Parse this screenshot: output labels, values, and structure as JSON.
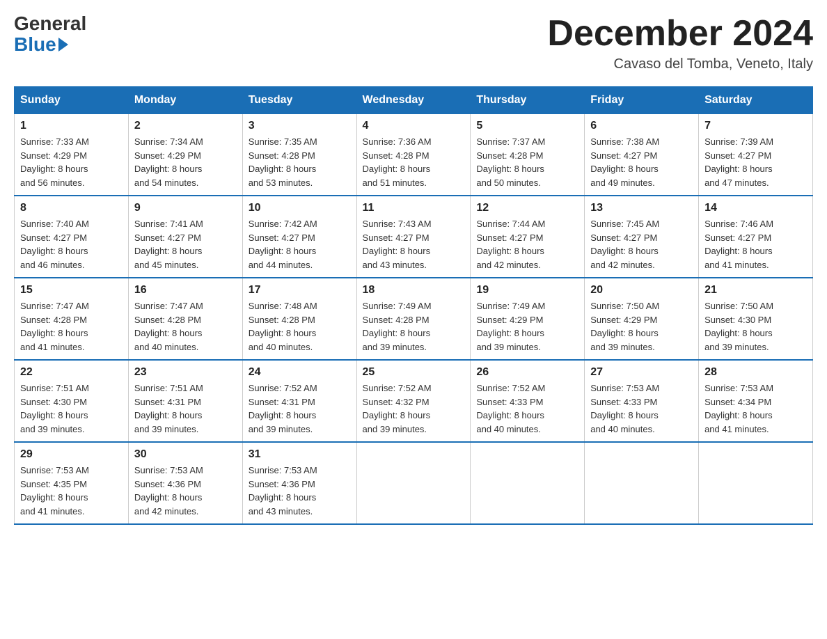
{
  "logo": {
    "general": "General",
    "blue": "Blue"
  },
  "title": "December 2024",
  "location": "Cavaso del Tomba, Veneto, Italy",
  "days_of_week": [
    "Sunday",
    "Monday",
    "Tuesday",
    "Wednesday",
    "Thursday",
    "Friday",
    "Saturday"
  ],
  "weeks": [
    [
      {
        "day": "1",
        "sunrise": "7:33 AM",
        "sunset": "4:29 PM",
        "daylight": "8 hours and 56 minutes."
      },
      {
        "day": "2",
        "sunrise": "7:34 AM",
        "sunset": "4:29 PM",
        "daylight": "8 hours and 54 minutes."
      },
      {
        "day": "3",
        "sunrise": "7:35 AM",
        "sunset": "4:28 PM",
        "daylight": "8 hours and 53 minutes."
      },
      {
        "day": "4",
        "sunrise": "7:36 AM",
        "sunset": "4:28 PM",
        "daylight": "8 hours and 51 minutes."
      },
      {
        "day": "5",
        "sunrise": "7:37 AM",
        "sunset": "4:28 PM",
        "daylight": "8 hours and 50 minutes."
      },
      {
        "day": "6",
        "sunrise": "7:38 AM",
        "sunset": "4:27 PM",
        "daylight": "8 hours and 49 minutes."
      },
      {
        "day": "7",
        "sunrise": "7:39 AM",
        "sunset": "4:27 PM",
        "daylight": "8 hours and 47 minutes."
      }
    ],
    [
      {
        "day": "8",
        "sunrise": "7:40 AM",
        "sunset": "4:27 PM",
        "daylight": "8 hours and 46 minutes."
      },
      {
        "day": "9",
        "sunrise": "7:41 AM",
        "sunset": "4:27 PM",
        "daylight": "8 hours and 45 minutes."
      },
      {
        "day": "10",
        "sunrise": "7:42 AM",
        "sunset": "4:27 PM",
        "daylight": "8 hours and 44 minutes."
      },
      {
        "day": "11",
        "sunrise": "7:43 AM",
        "sunset": "4:27 PM",
        "daylight": "8 hours and 43 minutes."
      },
      {
        "day": "12",
        "sunrise": "7:44 AM",
        "sunset": "4:27 PM",
        "daylight": "8 hours and 42 minutes."
      },
      {
        "day": "13",
        "sunrise": "7:45 AM",
        "sunset": "4:27 PM",
        "daylight": "8 hours and 42 minutes."
      },
      {
        "day": "14",
        "sunrise": "7:46 AM",
        "sunset": "4:27 PM",
        "daylight": "8 hours and 41 minutes."
      }
    ],
    [
      {
        "day": "15",
        "sunrise": "7:47 AM",
        "sunset": "4:28 PM",
        "daylight": "8 hours and 41 minutes."
      },
      {
        "day": "16",
        "sunrise": "7:47 AM",
        "sunset": "4:28 PM",
        "daylight": "8 hours and 40 minutes."
      },
      {
        "day": "17",
        "sunrise": "7:48 AM",
        "sunset": "4:28 PM",
        "daylight": "8 hours and 40 minutes."
      },
      {
        "day": "18",
        "sunrise": "7:49 AM",
        "sunset": "4:28 PM",
        "daylight": "8 hours and 39 minutes."
      },
      {
        "day": "19",
        "sunrise": "7:49 AM",
        "sunset": "4:29 PM",
        "daylight": "8 hours and 39 minutes."
      },
      {
        "day": "20",
        "sunrise": "7:50 AM",
        "sunset": "4:29 PM",
        "daylight": "8 hours and 39 minutes."
      },
      {
        "day": "21",
        "sunrise": "7:50 AM",
        "sunset": "4:30 PM",
        "daylight": "8 hours and 39 minutes."
      }
    ],
    [
      {
        "day": "22",
        "sunrise": "7:51 AM",
        "sunset": "4:30 PM",
        "daylight": "8 hours and 39 minutes."
      },
      {
        "day": "23",
        "sunrise": "7:51 AM",
        "sunset": "4:31 PM",
        "daylight": "8 hours and 39 minutes."
      },
      {
        "day": "24",
        "sunrise": "7:52 AM",
        "sunset": "4:31 PM",
        "daylight": "8 hours and 39 minutes."
      },
      {
        "day": "25",
        "sunrise": "7:52 AM",
        "sunset": "4:32 PM",
        "daylight": "8 hours and 39 minutes."
      },
      {
        "day": "26",
        "sunrise": "7:52 AM",
        "sunset": "4:33 PM",
        "daylight": "8 hours and 40 minutes."
      },
      {
        "day": "27",
        "sunrise": "7:53 AM",
        "sunset": "4:33 PM",
        "daylight": "8 hours and 40 minutes."
      },
      {
        "day": "28",
        "sunrise": "7:53 AM",
        "sunset": "4:34 PM",
        "daylight": "8 hours and 41 minutes."
      }
    ],
    [
      {
        "day": "29",
        "sunrise": "7:53 AM",
        "sunset": "4:35 PM",
        "daylight": "8 hours and 41 minutes."
      },
      {
        "day": "30",
        "sunrise": "7:53 AM",
        "sunset": "4:36 PM",
        "daylight": "8 hours and 42 minutes."
      },
      {
        "day": "31",
        "sunrise": "7:53 AM",
        "sunset": "4:36 PM",
        "daylight": "8 hours and 43 minutes."
      },
      null,
      null,
      null,
      null
    ]
  ],
  "labels": {
    "sunrise": "Sunrise:",
    "sunset": "Sunset:",
    "daylight": "Daylight:"
  }
}
